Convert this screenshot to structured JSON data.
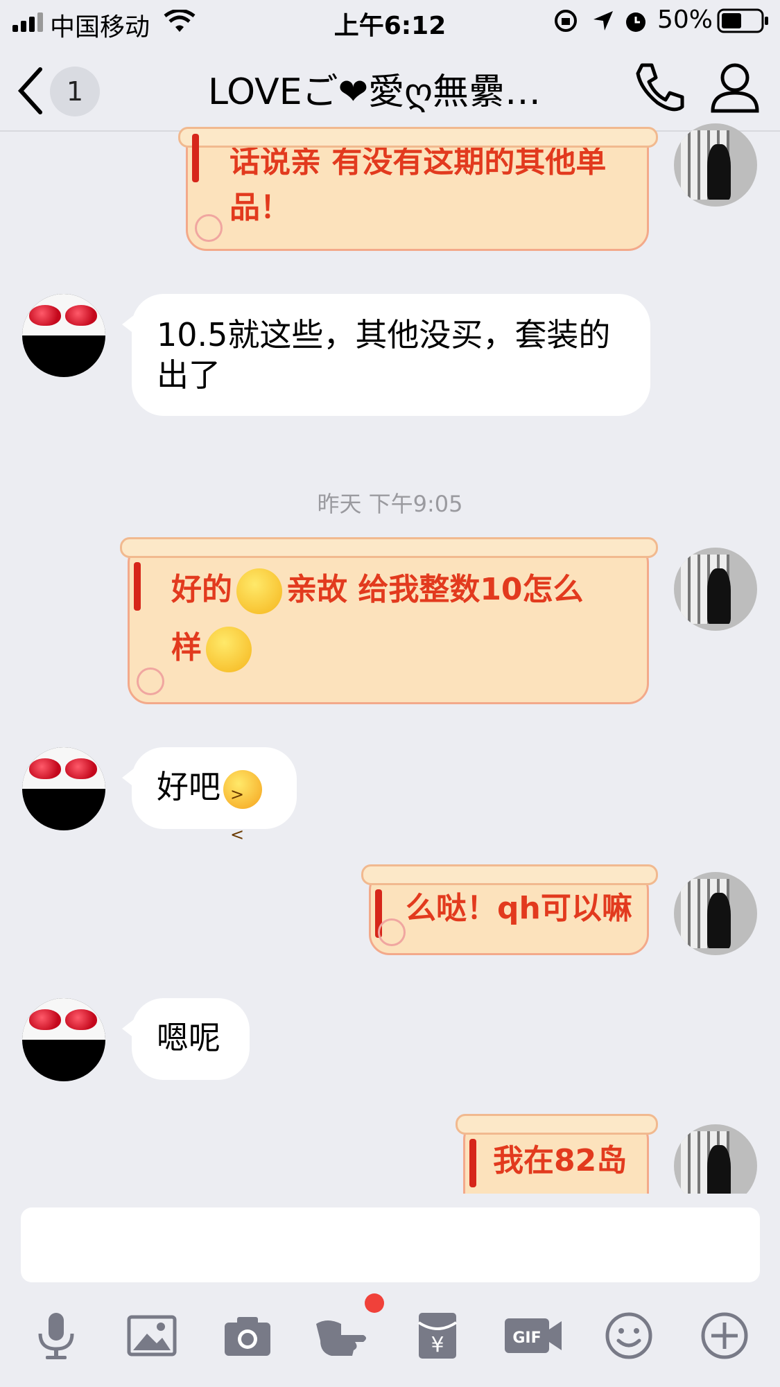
{
  "status_bar": {
    "carrier": "中国移动",
    "time": "上午6:12",
    "battery_percent": "50%"
  },
  "nav": {
    "unread_count": "1",
    "title": "LOVEご❤愛ღ無纍…"
  },
  "messages": [
    {
      "side": "right",
      "style": "scroll",
      "text_line1": "话说亲 有没有这期的其他单",
      "text_line2": "品！"
    },
    {
      "side": "left",
      "style": "plain",
      "text": "10.5就这些，其他没买，套装的出了"
    },
    {
      "timestamp": "昨天 下午9:05"
    },
    {
      "side": "right",
      "style": "scroll",
      "text_a": "好的",
      "text_b": "亲故 给我整数10怎么",
      "text_c": "样",
      "emoji": [
        "blushing-face",
        "grinning-face"
      ]
    },
    {
      "side": "left",
      "style": "plain",
      "text": "好吧",
      "emoji": "persevering-face"
    },
    {
      "side": "right",
      "style": "scroll",
      "text": "么哒！qh可以嘛"
    },
    {
      "side": "left",
      "style": "plain",
      "text": "嗯呢"
    },
    {
      "side": "right",
      "style": "scroll",
      "text": "我在82岛"
    }
  ],
  "toolbar": {
    "items": [
      "microphone-icon",
      "image-icon",
      "camera-icon",
      "poke-hand-icon",
      "red-packet-icon",
      "gif-icon",
      "emoji-icon",
      "plus-icon"
    ],
    "badge_color": "#f0413a"
  },
  "colors": {
    "background": "#ecedf2",
    "scroll_fill": "#fce2bc",
    "scroll_text": "#e23a1e"
  }
}
